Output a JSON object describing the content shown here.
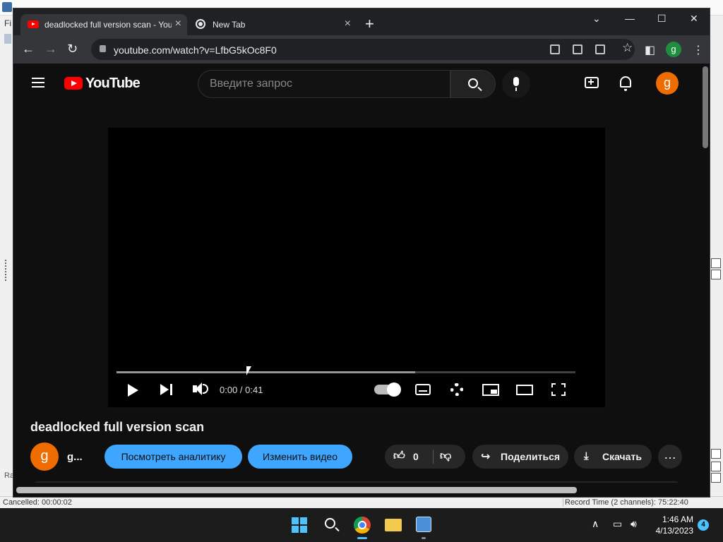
{
  "background_app": {
    "menu_fragment": "Fi",
    "left_fragment": "Ra",
    "status_left": "Cancelled: 00:00:02",
    "status_right": "Record Time (2 channels): 75:22:40"
  },
  "browser": {
    "tabs": [
      {
        "title": "deadlocked full version scan - YouTube",
        "active": true
      },
      {
        "title": "New Tab",
        "active": false
      }
    ],
    "new_tab_label": "+",
    "url": "youtube.com/watch?v=LfbG5kOc8F0",
    "profile_initial": "g"
  },
  "youtube": {
    "logo_text": "YouTube",
    "search_placeholder": "Введите запрос",
    "avatar_initial": "g",
    "player": {
      "time": "0:00 / 0:41",
      "progress_loaded": 0.65
    },
    "video_title": "deadlocked full version scan",
    "channel": {
      "initial": "g",
      "name": "g..."
    },
    "buttons": {
      "analytics": "Посмотреть аналитику",
      "edit": "Изменить видео",
      "likes": "0",
      "share": "Поделиться",
      "download": "Скачать"
    }
  },
  "taskbar": {
    "time": "1:46 AM",
    "date": "4/13/2023",
    "notifications": "4",
    "accent": "#4cc2ff"
  }
}
